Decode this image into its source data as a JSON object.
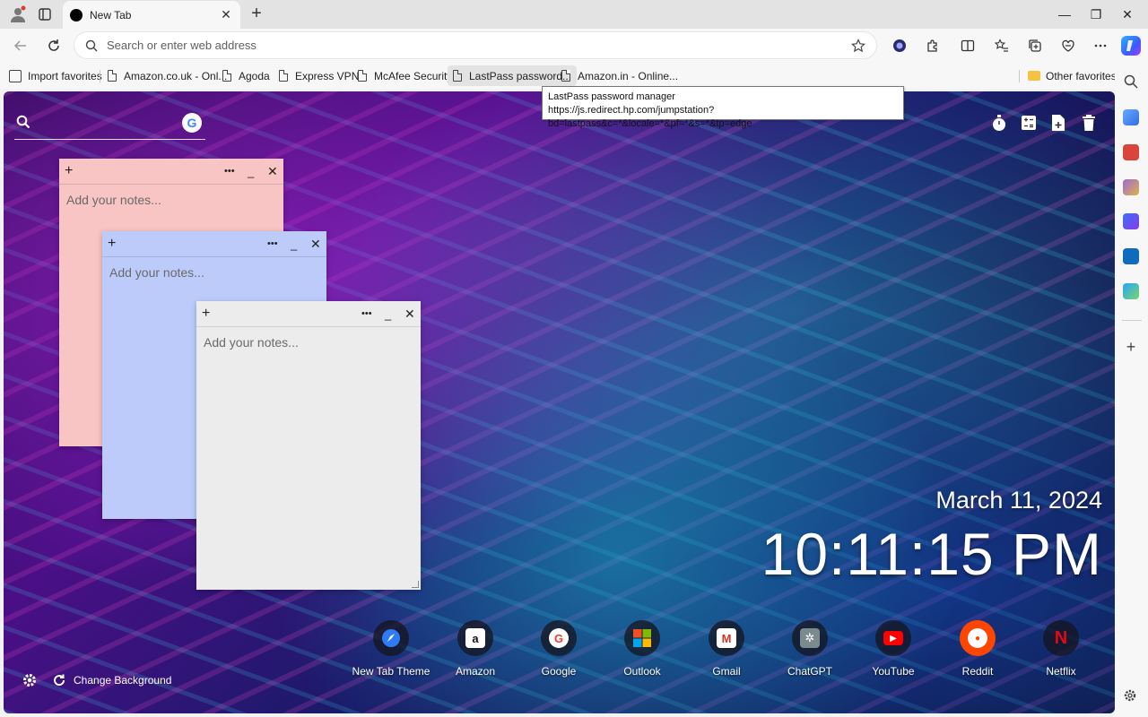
{
  "tab": {
    "title": "New Tab",
    "close": "✕",
    "new": "+"
  },
  "window_controls": {
    "minimize": "—",
    "maximize": "❐",
    "close": "✕"
  },
  "address_bar": {
    "placeholder": "Search or enter web address"
  },
  "favorites": [
    {
      "label": "Import favorites",
      "icon": "import-icon"
    },
    {
      "label": "Amazon.co.uk - Onl...",
      "icon": "page-icon"
    },
    {
      "label": "Agoda",
      "icon": "page-icon"
    },
    {
      "label": "Express VPN",
      "icon": "page-icon"
    },
    {
      "label": "McAfee Security",
      "icon": "page-icon"
    },
    {
      "label": "LastPass password...",
      "icon": "page-icon"
    },
    {
      "label": "Amazon.in - Online...",
      "icon": "page-icon"
    }
  ],
  "other_favorites": "Other favorites",
  "tooltip": {
    "title": "LastPass password manager",
    "url": "https://js.redirect.hp.com/jumpstation?bd=lastpass&c=*&locale=*&pf=*&s=*&tp=edge"
  },
  "newtab": {
    "search_engine_badge": "G",
    "notes": [
      {
        "placeholder": "Add your notes...",
        "color": "#f9c4c4"
      },
      {
        "placeholder": "Add your notes...",
        "color": "#bccbfa"
      },
      {
        "placeholder": "Add your notes...",
        "color": "#ececec"
      }
    ],
    "note_controls": {
      "add": "+",
      "menu": "•••",
      "minimize": "_",
      "close": "✕"
    },
    "date": "March 11, 2024",
    "time": "10:11:15 PM",
    "shortcuts": [
      {
        "label": "New Tab Theme",
        "icon": "rocket-icon"
      },
      {
        "label": "Amazon",
        "icon": "amazon-icon",
        "glyph": "a"
      },
      {
        "label": "Google",
        "icon": "google-icon",
        "glyph": "G"
      },
      {
        "label": "Outlook",
        "icon": "outlook-icon"
      },
      {
        "label": "Gmail",
        "icon": "gmail-icon",
        "glyph": "M"
      },
      {
        "label": "ChatGPT",
        "icon": "chatgpt-icon",
        "glyph": "✲"
      },
      {
        "label": "YouTube",
        "icon": "youtube-icon",
        "glyph": "▶"
      },
      {
        "label": "Reddit",
        "icon": "reddit-icon",
        "glyph": "●"
      },
      {
        "label": "Netflix",
        "icon": "netflix-icon",
        "glyph": "N"
      }
    ],
    "change_background": "Change Background"
  },
  "sidebar": {
    "add": "+"
  }
}
